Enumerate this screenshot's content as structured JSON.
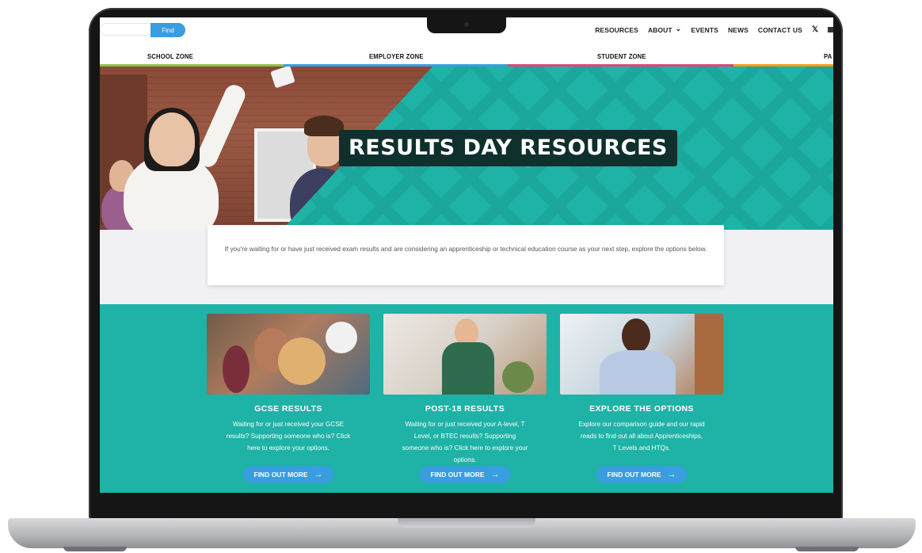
{
  "header": {
    "search": {
      "value": "",
      "placeholder": "",
      "button_label": "Find"
    },
    "nav": [
      {
        "label": "RESOURCES"
      },
      {
        "label": "ABOUT",
        "has_dropdown": true
      },
      {
        "label": "EVENTS"
      },
      {
        "label": "NEWS"
      },
      {
        "label": "CONTACT US"
      }
    ],
    "social_icons": [
      "x-icon",
      "square-icon"
    ]
  },
  "zones": [
    {
      "label": "SCHOOL ZONE",
      "color": "#8bc34a"
    },
    {
      "label": "EMPLOYER ZONE",
      "color": "#3a9de0"
    },
    {
      "label": "STUDENT ZONE",
      "color": "#e0457b"
    },
    {
      "label": "PA",
      "color": "#f39c12"
    }
  ],
  "hero": {
    "title": "RESULTS DAY RESOURCES"
  },
  "intro": {
    "text": "If you're waiting for or have just received exam results and are considering an apprenticeship or technical education course as your next step, explore the options below."
  },
  "cards": [
    {
      "title": "GCSE RESULTS",
      "text": "Waiting for or just received your GCSE results? Supporting someone who is? Click here to explore your options.",
      "button": "FIND OUT MORE"
    },
    {
      "title": "POST-18 RESULTS",
      "text": "Waiting for or just received your A-level, T Level, or BTEC results? Supporting someone who is? Click here to explore your options.",
      "button": "FIND OUT MORE"
    },
    {
      "title": "EXPLORE THE OPTIONS",
      "text": "Explore our comparison guide and our rapid reads to find out all about Apprenticeships, T Levels and HTQs.",
      "button": "FIND OUT MORE"
    }
  ],
  "colors": {
    "teal": "#1fb2a6",
    "accent_blue": "#3a9de0",
    "title_bg": "#0f302d"
  }
}
